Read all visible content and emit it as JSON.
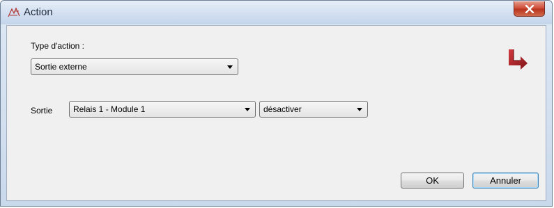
{
  "window": {
    "title": "Action",
    "close_symbol": "x"
  },
  "form": {
    "action_type_label": "Type d'action :",
    "action_type_value": "Sortie externe",
    "output_label": "Sortie",
    "output_value": "Relais 1 - Module 1",
    "state_value": "désactiver"
  },
  "buttons": {
    "ok_label": "OK",
    "cancel_label": "Annuler"
  },
  "colors": {
    "close_button": "#c74a33",
    "logo": "#b0232a"
  }
}
